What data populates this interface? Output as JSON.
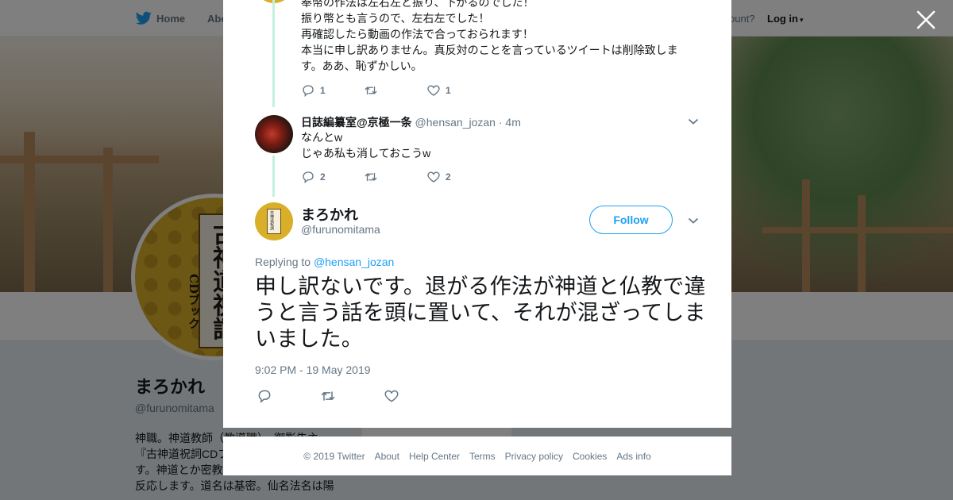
{
  "nav": {
    "home": "Home",
    "about": "Abo",
    "account_prompt": "ccount?",
    "login": "Log in"
  },
  "profile": {
    "name": "まろかれ",
    "handle": "@furunomitama",
    "bio": "神職。神道教師（教導職）。御影告主。『古神道祝詞CDブ で買えます。祝詞 す。神道とか密教とか陰陽道とか仙道に反応します。道名は基密。仙名法名は陽",
    "side_card_text": "Ads info",
    "avatar_text_main": "古神道祝詞",
    "avatar_text_sub": "CDブック"
  },
  "thread": {
    "first_tweet": {
      "lines": [
        "奉幣の作法は左右左と振り、下がるのでした！",
        "振り幣とも言うので、左右左でした！",
        "再確認したら動画の作法で合っておられます！",
        "本当に申し訳ありません。真反対のことを言っているツイートは削除致しま",
        "す。ああ、恥ずかしい。"
      ],
      "reply_count": "1",
      "retweet_count": "",
      "like_count": "1"
    },
    "second_tweet": {
      "name": "日誌編纂室@京極一条",
      "handle": "@hensan_jozan",
      "dot": "·",
      "time": "4m",
      "lines": [
        "なんとw",
        "じゃあ私も消しておこうw"
      ],
      "reply_count": "2",
      "retweet_count": "",
      "like_count": "2"
    }
  },
  "main_tweet": {
    "name": "まろかれ",
    "handle": "@furunomitama",
    "follow_label": "Follow",
    "replying_prefix": "Replying to",
    "replying_to": "@hensan_jozan",
    "text": "申し訳ないです。退がる作法が神道と仏教で違うと言う話を頭に置いて、それが混ざってしまいました。",
    "timestamp": "9:02 PM - 19 May 2019",
    "avatar_text": "古神道祝詞"
  },
  "footer": {
    "copyright": "© 2019 Twitter",
    "links": [
      "About",
      "Help Center",
      "Terms",
      "Privacy policy",
      "Cookies",
      "Ads info"
    ]
  },
  "colors": {
    "brand_blue": "#1da1f2",
    "thread_line": "#c4f0de",
    "muted": "#657786",
    "overlay": "rgba(0,0,0,0.5)"
  },
  "icons": {
    "logo": "twitter-bird-icon",
    "close": "close-icon",
    "reply": "reply-icon",
    "retweet": "retweet-icon",
    "like": "heart-icon",
    "caret": "chevron-down-icon"
  }
}
